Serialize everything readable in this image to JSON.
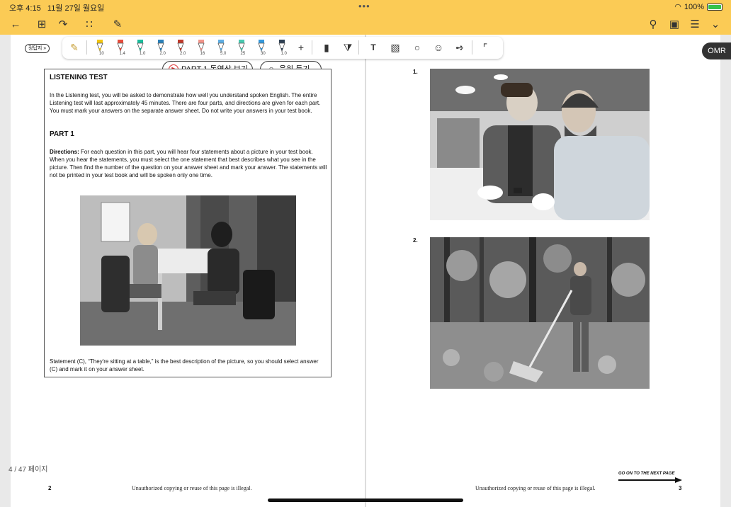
{
  "status": {
    "time": "오후 4:15",
    "date": "11월 27일 월요일",
    "battery": "100%",
    "dots": "•••"
  },
  "toolbar_icons": {
    "back": "back-arrow-icon",
    "grid": "grid-icon",
    "share": "share-icon",
    "apps": "apps-grid-icon",
    "edit": "edit-document-icon",
    "search": "search-icon",
    "bookmark": "bookmark-icon",
    "menu": "list-menu-icon",
    "chevron": "chevron-down-icon"
  },
  "answer_key_label": "정답지 »",
  "pens": [
    {
      "color": "#f1c40f",
      "size": "10"
    },
    {
      "color": "#e74c3c",
      "size": "1.4"
    },
    {
      "color": "#1abc9c",
      "size": "1.0"
    },
    {
      "color": "#2980b9",
      "size": "2.0"
    },
    {
      "color": "#c0392b",
      "size": "2.0"
    },
    {
      "color": "#f1948a",
      "size": "16"
    },
    {
      "color": "#5dade2",
      "size": "5.0"
    },
    {
      "color": "#48c9b0",
      "size": "25"
    },
    {
      "color": "#3498db",
      "size": "30"
    },
    {
      "color": "#2e4053",
      "size": "1.0"
    }
  ],
  "omr_label": "OMR",
  "pills": {
    "video": "PART 1 동영상 보기",
    "audio": "음원 듣기"
  },
  "listening": {
    "title": "LISTENING TEST",
    "intro": "In the Listening test, you will be asked to demonstrate how well you understand spoken English. The entire Listening test will last approximately 45 minutes. There are four parts, and directions are given for each part. You must mark your answers on the separate answer sheet. Do not write your answers in your test book.",
    "part": "PART 1",
    "directions_label": "Directions:",
    "directions": " For each question in this part, you will hear four statements about a picture in your test book. When you hear the statements, you must select the one statement that best describes what you see in the picture. Then find the number of the question on your answer sheet and mark your answer. The statements will not be printed in your test book and will be spoken only one time.",
    "statement": "Statement (C), “They're sitting at a table,” is the best description of the picture, so you should select answer (C) and mark it on your answer sheet."
  },
  "questions": [
    {
      "number": "1."
    },
    {
      "number": "2."
    }
  ],
  "footer": {
    "left_page": "2",
    "right_page": "3",
    "copy_note": "Unauthorized copying or reuse of this page is illegal.",
    "go_on": "GO ON TO THE NEXT PAGE",
    "page_indicator": "4 / 47 페이지"
  }
}
